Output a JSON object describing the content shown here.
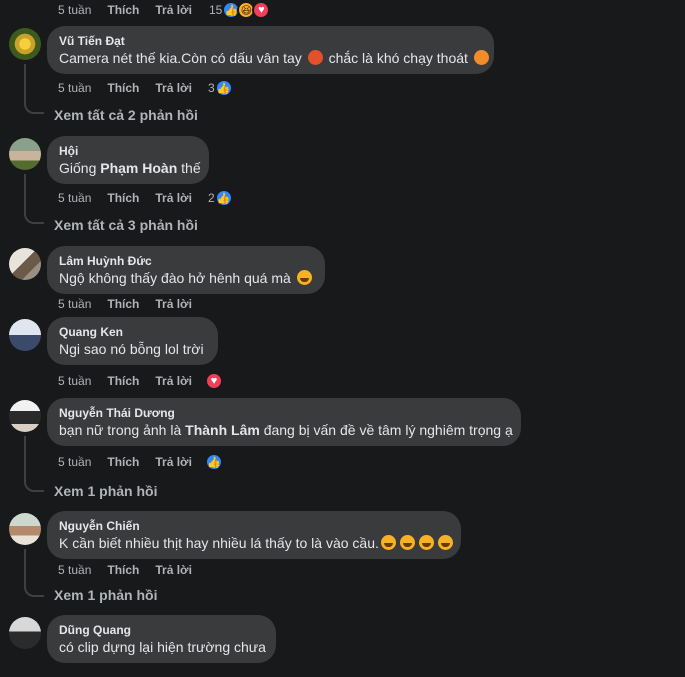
{
  "top_actions": {
    "time": "5 tuần",
    "like": "Thích",
    "reply": "Trả lời",
    "count": "15"
  },
  "comments": [
    {
      "name": "Vũ Tiến Đạt",
      "text_a": "Camera nét thế kia.Còn có dấu vân tay",
      "text_b": "chắc là khó chạy thoát",
      "time": "5 tuần",
      "like": "Thích",
      "reply": "Trả lời",
      "count": "3",
      "replies": "Xem tất cả 2 phản hồi"
    },
    {
      "name": "Hội",
      "text_a": "Giống ",
      "bold": "Phạm Hoàn",
      "text_b": " thế",
      "time": "5 tuần",
      "like": "Thích",
      "reply": "Trả lời",
      "count": "2",
      "replies": "Xem tất cả 3 phản hồi"
    },
    {
      "name": "Lâm Huỳnh Đức",
      "text": "Ngộ không thấy đào hở hênh quá mà",
      "time": "5 tuần",
      "like": "Thích",
      "reply": "Trả lời"
    },
    {
      "name": "Quang Ken",
      "text": "Ngi sao nó bỗng lol trời",
      "time": "5 tuần",
      "like": "Thích",
      "reply": "Trả lời"
    },
    {
      "name": "Nguyễn Thái Dương",
      "text_a": "bạn nữ trong ảnh là ",
      "bold": "Thành Lâm",
      "text_b": " đang bị vấn đề về tâm lý nghiêm trọng ạ",
      "time": "5 tuần",
      "like": "Thích",
      "reply": "Trả lời",
      "replies": "Xem 1 phản hồi"
    },
    {
      "name": "Nguyễn Chiến",
      "text": "K cần biết nhiều thịt hay nhiều lá thấy to là vào cầu.",
      "time": "5 tuần",
      "like": "Thích",
      "reply": "Trả lời",
      "replies": "Xem 1 phản hồi"
    },
    {
      "name": "Dũng Quang",
      "text": "có clip dựng lại hiện trường chưa"
    }
  ],
  "colors": {
    "bg": "#18191a",
    "bubble": "#3a3b3c",
    "text": "#e4e6eb",
    "muted": "#b0b3b8",
    "like": "#2d88ff",
    "love": "#f33e58",
    "haha": "#f7b125"
  }
}
